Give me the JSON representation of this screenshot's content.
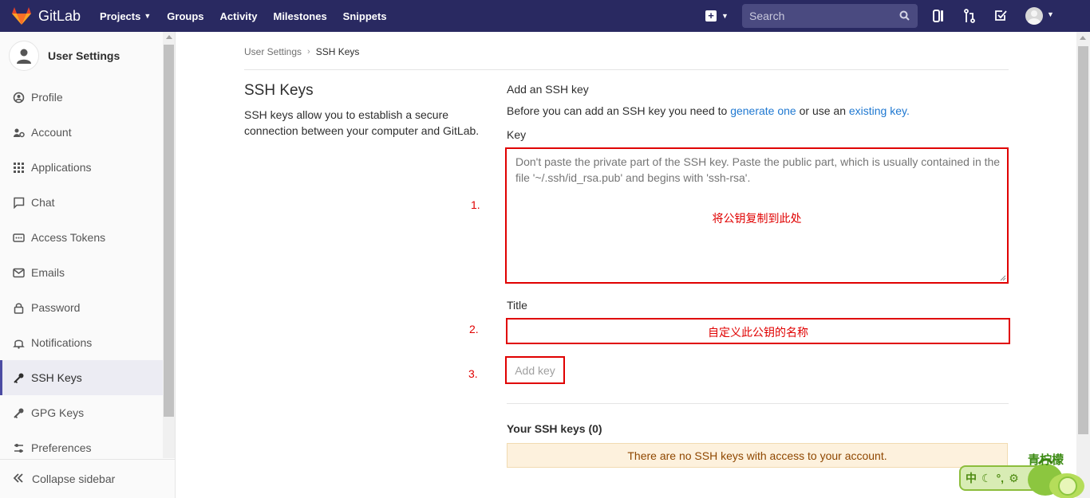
{
  "navbar": {
    "brand": "GitLab",
    "links": [
      {
        "label": "Projects",
        "has_caret": true
      },
      {
        "label": "Groups",
        "has_caret": false
      },
      {
        "label": "Activity",
        "has_caret": false
      },
      {
        "label": "Milestones",
        "has_caret": false
      },
      {
        "label": "Snippets",
        "has_caret": false
      }
    ],
    "search_placeholder": "Search",
    "accent": "#292961"
  },
  "sidebar": {
    "title": "User Settings",
    "items": [
      {
        "label": "Profile",
        "icon": "profile-icon"
      },
      {
        "label": "Account",
        "icon": "account-icon"
      },
      {
        "label": "Applications",
        "icon": "applications-icon"
      },
      {
        "label": "Chat",
        "icon": "chat-icon"
      },
      {
        "label": "Access Tokens",
        "icon": "token-icon"
      },
      {
        "label": "Emails",
        "icon": "email-icon"
      },
      {
        "label": "Password",
        "icon": "lock-icon"
      },
      {
        "label": "Notifications",
        "icon": "bell-icon"
      },
      {
        "label": "SSH Keys",
        "icon": "key-icon",
        "active": true
      },
      {
        "label": "GPG Keys",
        "icon": "key-icon"
      },
      {
        "label": "Preferences",
        "icon": "preferences-icon"
      }
    ],
    "collapse_label": "Collapse sidebar"
  },
  "breadcrumb": {
    "parent": "User Settings",
    "current": "SSH Keys"
  },
  "intro": {
    "title": "SSH Keys",
    "description": "SSH keys allow you to establish a secure connection between your computer and GitLab."
  },
  "form": {
    "heading": "Add an SSH key",
    "desc_before": "Before you can add an SSH key you need to ",
    "link_generate": "generate one",
    "desc_middle": " or use an ",
    "link_existing": "existing key.",
    "key_label": "Key",
    "key_placeholder": "Don't paste the private part of the SSH key. Paste the public part, which is usually contained in the file '~/.ssh/id_rsa.pub' and begins with 'ssh-rsa'.",
    "key_annotation": "将公钥复制到此处",
    "title_label": "Title",
    "title_annotation": "自定义此公钥的名称",
    "add_button": "Add key"
  },
  "steps": [
    "1.",
    "2.",
    "3."
  ],
  "keys_list": {
    "heading": "Your SSH keys (0)",
    "empty_message": "There are no SSH keys with access to your account."
  },
  "ime": {
    "label": "青柠檬",
    "bar_text": "中"
  },
  "colors": {
    "annotation_red": "#e00000",
    "link_blue": "#1f78d1",
    "active_bar": "#4b4ba3",
    "warning_bg": "#fdf1dd"
  }
}
